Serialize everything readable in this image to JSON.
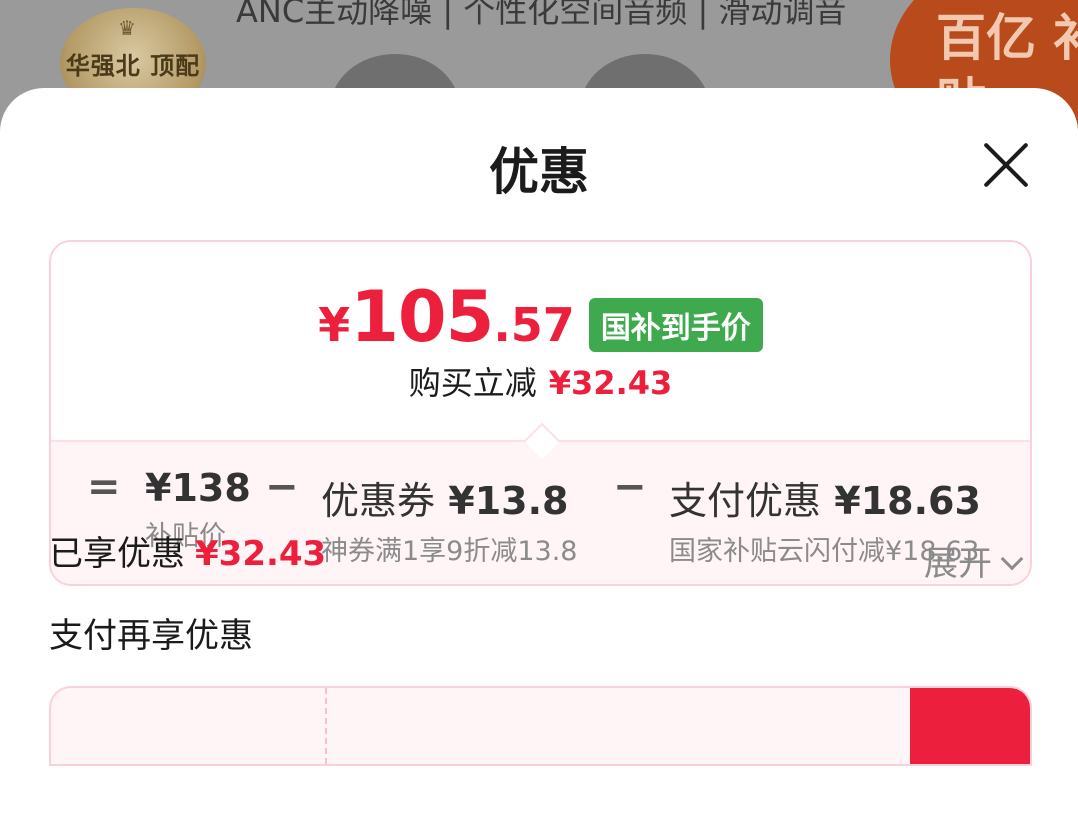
{
  "background": {
    "tagline": "ANC主动降噪 | 个性化空间音频 | 滑动调音",
    "seal_text": "华强北 顶配版",
    "badge_text": "百亿 补贴"
  },
  "sheet": {
    "title": "优惠"
  },
  "price_card": {
    "final_price_symbol": "¥",
    "final_price_integer": "105",
    "final_price_decimal": ".57",
    "final_price_tag": "国补到手价",
    "instant_discount_label": "购买立减",
    "instant_discount_amount": "¥32.43",
    "breakdown": {
      "equals": "=",
      "minus": "−",
      "base_price": "¥138",
      "base_label": "补贴价",
      "coupon_label": "优惠券",
      "coupon_amount": "¥13.8",
      "coupon_desc": "神券满1享9折减13.8",
      "payment_label": "支付优惠",
      "payment_amount": "¥18.63",
      "payment_desc": "国家补贴云闪付减¥18.63"
    }
  },
  "enjoyed": {
    "label": "已享优惠",
    "amount": "¥32.43",
    "expand_label": "展开"
  },
  "pay_more": {
    "title": "支付再享优惠"
  },
  "colors": {
    "accent_red": "#ec1f3c",
    "tag_green": "#3fa94d",
    "card_border": "#fbd0d8",
    "card_tint": "#fff5f6"
  },
  "icons": [
    "close-icon",
    "chevron-down-icon"
  ]
}
